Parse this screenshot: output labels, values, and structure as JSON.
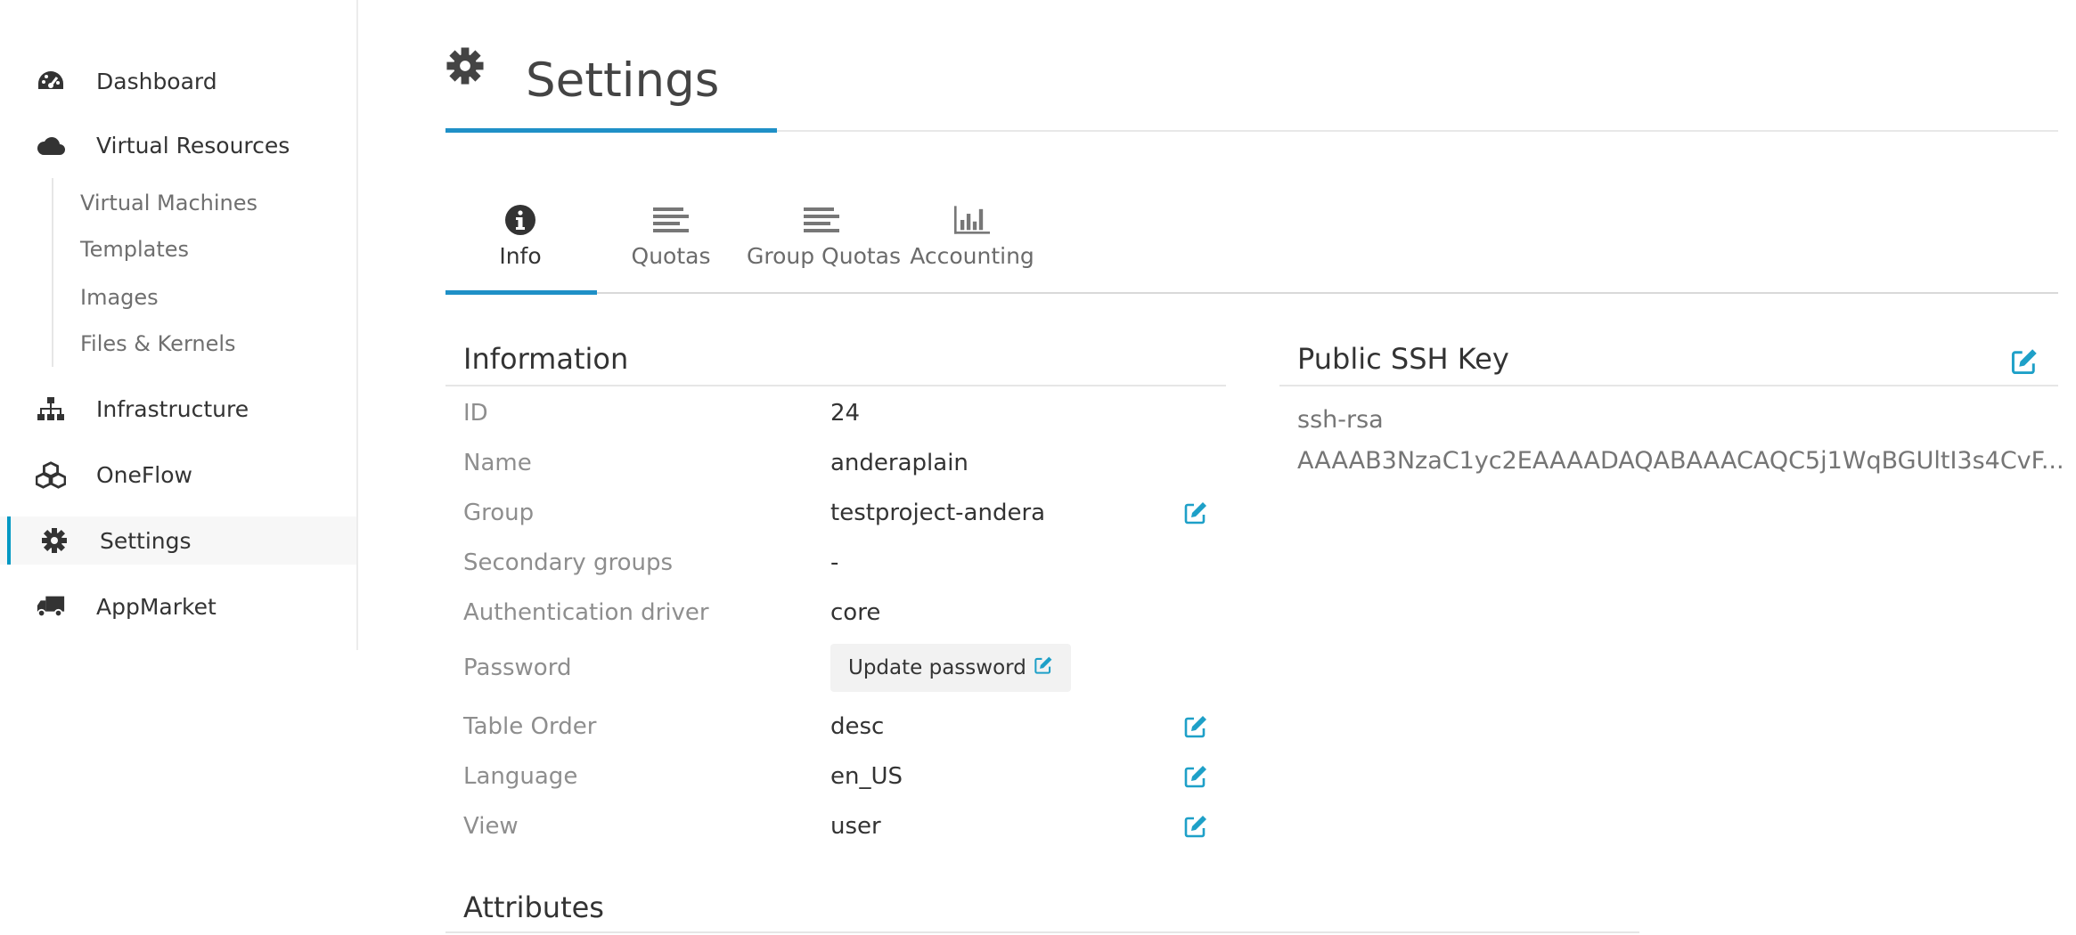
{
  "colors": {
    "accent": "#1f90c7",
    "edit_icon": "#1ea0c8",
    "text": "#333333",
    "muted": "#8e8e8e"
  },
  "sidebar": {
    "items": [
      {
        "label": "Dashboard",
        "icon": "tachometer-icon"
      },
      {
        "label": "Virtual Resources",
        "icon": "cloud-icon"
      },
      {
        "label": "Infrastructure",
        "icon": "sitemap-icon"
      },
      {
        "label": "OneFlow",
        "icon": "cubes-icon"
      },
      {
        "label": "Settings",
        "icon": "gear-icon",
        "active": true
      },
      {
        "label": "AppMarket",
        "icon": "truck-icon"
      }
    ],
    "sub_items": [
      "Virtual Machines",
      "Templates",
      "Images",
      "Files & Kernels"
    ]
  },
  "page": {
    "title": "Settings",
    "icon": "gear-icon"
  },
  "tabs": [
    {
      "label": "Info",
      "icon": "info-circle-icon",
      "active": true
    },
    {
      "label": "Quotas",
      "icon": "align-left-icon"
    },
    {
      "label": "Group Quotas",
      "icon": "align-left-icon"
    },
    {
      "label": "Accounting",
      "icon": "bar-chart-icon"
    }
  ],
  "information": {
    "title": "Information",
    "rows": [
      {
        "key": "ID",
        "value": "24"
      },
      {
        "key": "Name",
        "value": "anderaplain"
      },
      {
        "key": "Group",
        "value": "testproject-andera",
        "editable": true
      },
      {
        "key": "Secondary groups",
        "value": "-"
      },
      {
        "key": "Authentication driver",
        "value": "core"
      },
      {
        "key": "Password",
        "button": "Update password"
      },
      {
        "key": "Table Order",
        "value": "desc",
        "editable": true
      },
      {
        "key": "Language",
        "value": "en_US",
        "editable": true
      },
      {
        "key": "View",
        "value": "user",
        "editable": true
      }
    ]
  },
  "ssh": {
    "title": "Public SSH Key",
    "line1": "ssh-rsa",
    "line2": "AAAAB3NzaC1yc2EAAAADAQABAAACAQC5j1WqBGUltI3s4CvF..."
  },
  "attributes": {
    "title": "Attributes"
  }
}
